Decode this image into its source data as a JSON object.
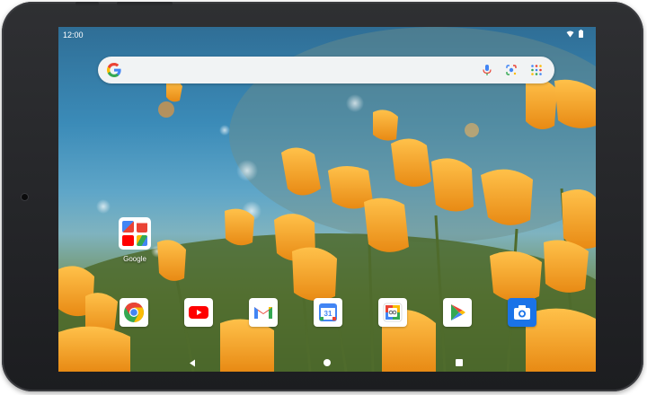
{
  "status_bar": {
    "time": "12:00",
    "icons": [
      "wifi-icon",
      "battery-icon"
    ]
  },
  "search_bar": {
    "placeholder": "",
    "icons": [
      "google-g-icon",
      "mic-icon",
      "lens-icon",
      "apps-grid-icon"
    ]
  },
  "folder": {
    "label": "Google",
    "apps": [
      "google-search-icon",
      "gmail-icon",
      "youtube-icon",
      "drive-icon"
    ]
  },
  "dock": {
    "apps": [
      "chrome-icon",
      "youtube-icon",
      "gmail-icon",
      "calendar-icon",
      "photos-icon",
      "play-store-icon",
      "camera-icon"
    ],
    "calendar_day": "31"
  },
  "nav_bar": {
    "buttons": [
      "back-icon",
      "home-icon",
      "recents-icon"
    ]
  },
  "colors": {
    "sky": "#3b8bb8",
    "poppy": "#f0a228",
    "stem": "#4f6b2c",
    "bezel": "#1f2023"
  }
}
